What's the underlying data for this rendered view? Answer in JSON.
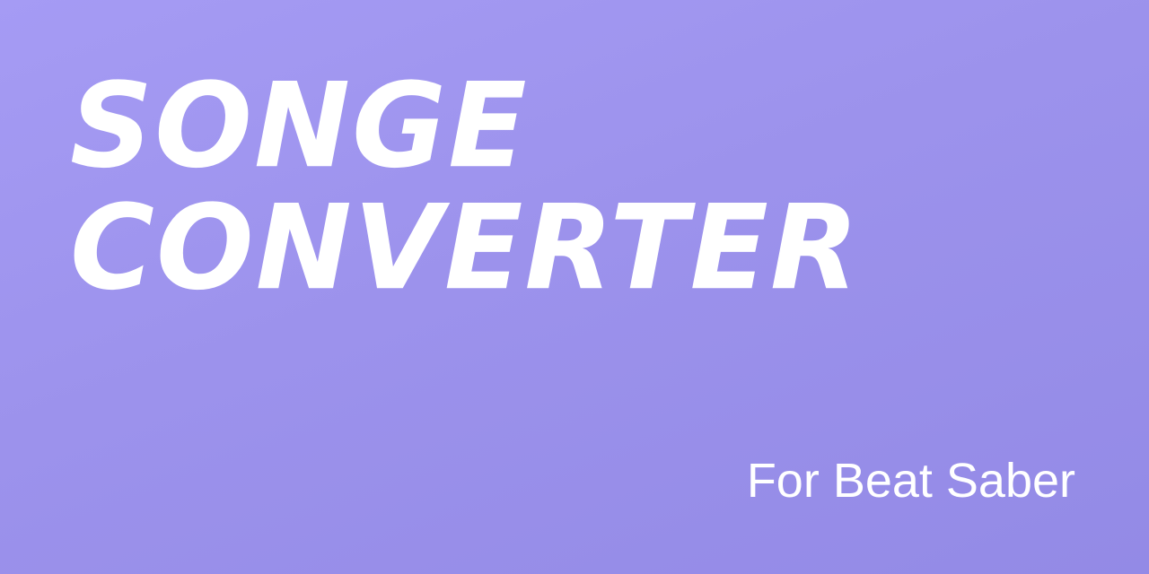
{
  "banner": {
    "title_line_1": "SONGE",
    "title_line_2": "CONVERTER",
    "subtitle": "For Beat Saber",
    "background_colors": [
      "#a59bf4",
      "#938ae6"
    ],
    "text_color": "#ffffff"
  }
}
